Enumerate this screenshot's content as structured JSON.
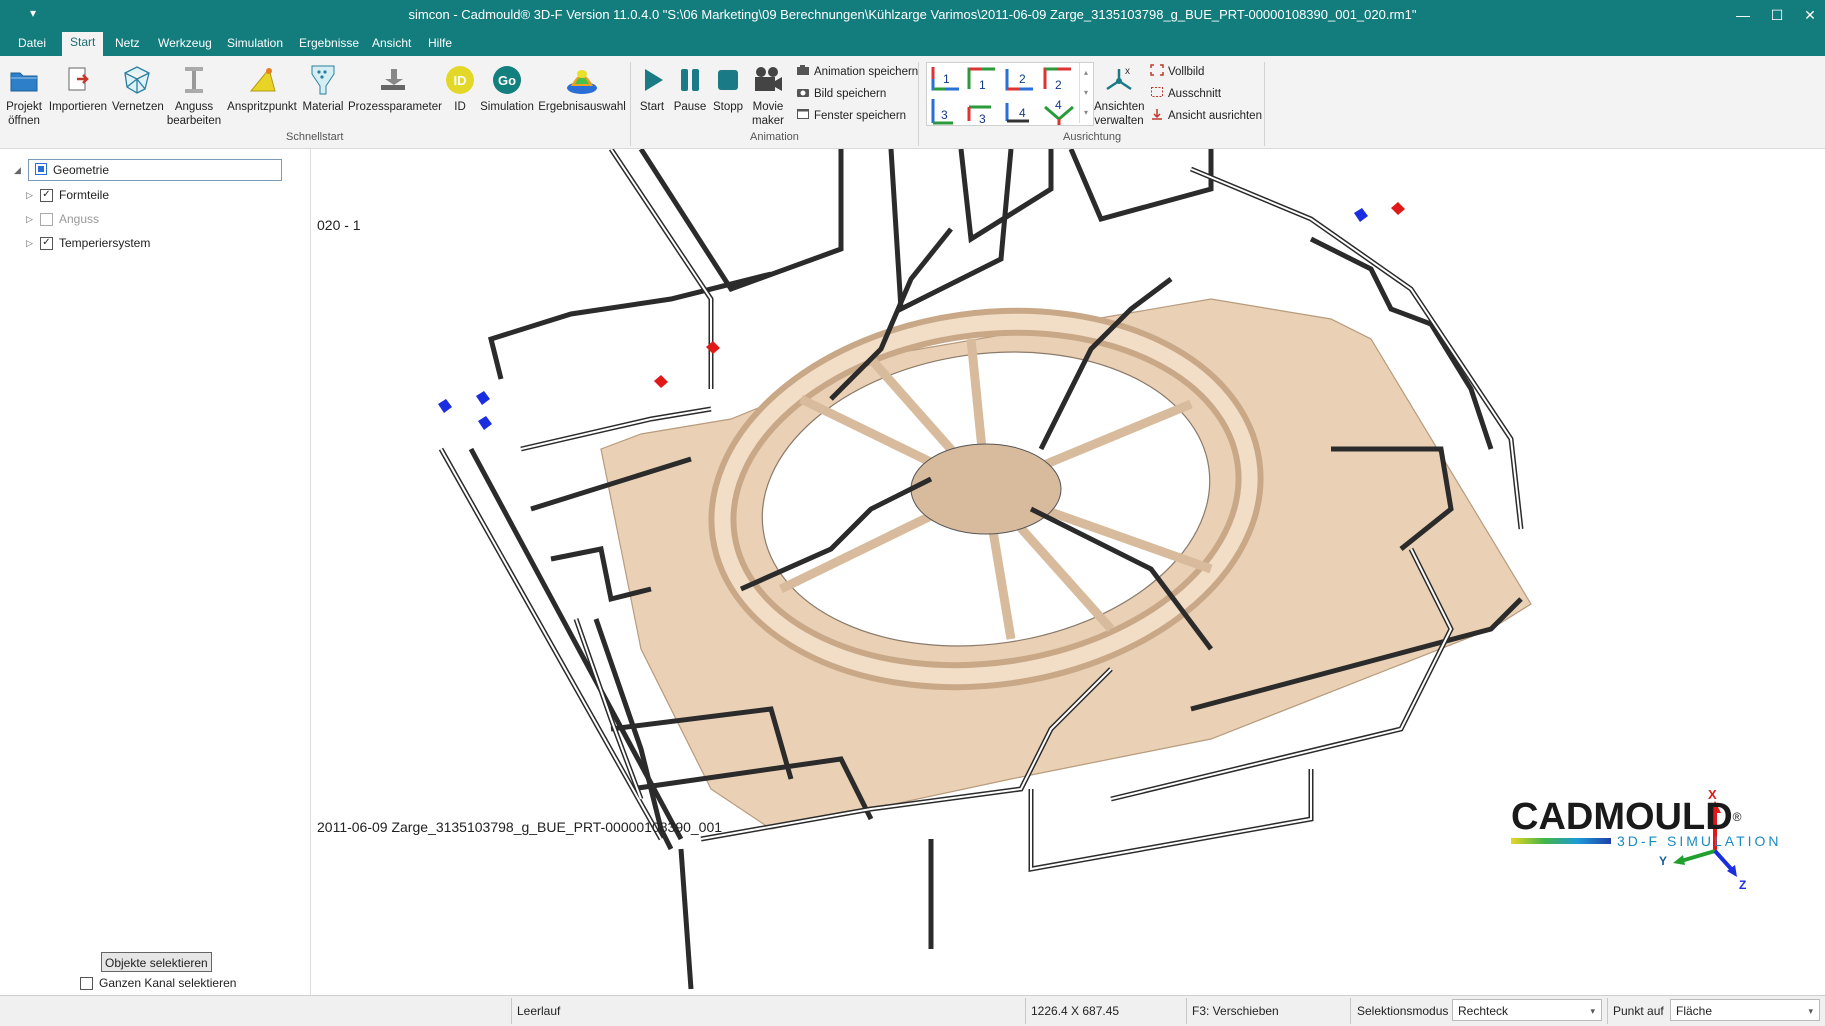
{
  "titlebar": {
    "qat_glyph": "▾",
    "title": "simcon - Cadmould® 3D-F Version 11.0.4.0     \"S:\\06 Marketing\\09 Berechnungen\\Kühlzarge Varimos\\2011-06-09 Zarge_3135103798_g_BUE_PRT-00000108390_001_020.rm1\"",
    "minimize": "—",
    "maximize": "☐",
    "close": "✕"
  },
  "menu": [
    "Datei",
    "Start",
    "Netz",
    "Werkzeug",
    "Simulation",
    "Ergebnisse",
    "Ansicht",
    "Hilfe"
  ],
  "ribbon": {
    "projekt": "Projekt\nöffnen",
    "importieren": "Importieren",
    "vernetzen": "Vernetzen",
    "anguss": "Anguss\nbearbeiten",
    "anspritz": "Anspritzpunkt",
    "material": "Material",
    "prozess": "Prozessparameter",
    "id": "ID",
    "id_badge": "ID",
    "simulation": "Simulation",
    "go_badge": "Go",
    "ergebnis": "Ergebnisauswahl",
    "group_schnellstart": "Schnellstart",
    "start": "Start",
    "pause": "Pause",
    "stopp": "Stopp",
    "movie": "Movie\nmaker",
    "anim_save": "Animation speichern",
    "bild_save": "Bild speichern",
    "fenster_save": "Fenster speichern",
    "group_animation": "Animation",
    "ansichten": "Ansichten\nverwalten",
    "vollbild": "Vollbild",
    "ausschnitt": "Ausschnitt",
    "ansicht_ausrichten": "Ansicht ausrichten",
    "group_ausrichtung": "Ausrichtung",
    "view_labels": [
      "1",
      "1",
      "2",
      "2",
      "3",
      "3",
      "4",
      "4"
    ]
  },
  "tree": {
    "root": "Geometrie",
    "items": [
      {
        "label": "Formteile",
        "checked": "✓"
      },
      {
        "label": "Anguss",
        "checked": ""
      },
      {
        "label": "Temperiersystem",
        "checked": "✓"
      }
    ]
  },
  "left_bottom": {
    "select_button": "Objekte selektieren",
    "channel_checkbox": "Ganzen Kanal selektieren"
  },
  "viewport": {
    "label_top": "020 - 1",
    "label_bottom": "2011-06-09 Zarge_3135103798_g_BUE_PRT-00000108390_001",
    "axis_x": "X",
    "axis_y": "Y",
    "axis_z": "Z",
    "logo_main": "CADMOULD",
    "logo_sub": "3D-F SIMULATION",
    "logo_reg": "®"
  },
  "statusbar": {
    "state": "Leerlauf",
    "coords": "1226.4 X 687.45",
    "hint": "F3: Verschieben",
    "selmode_label": "Selektionsmodus",
    "selmode_value": "Rechteck",
    "punkt_label": "Punkt auf",
    "punkt_value": "Fläche"
  },
  "colors": {
    "accent": "#137c7d",
    "part": "#ead1b5",
    "channel": "#2b2b2b",
    "inlet": "#1a2de0",
    "outlet": "#e01818"
  }
}
